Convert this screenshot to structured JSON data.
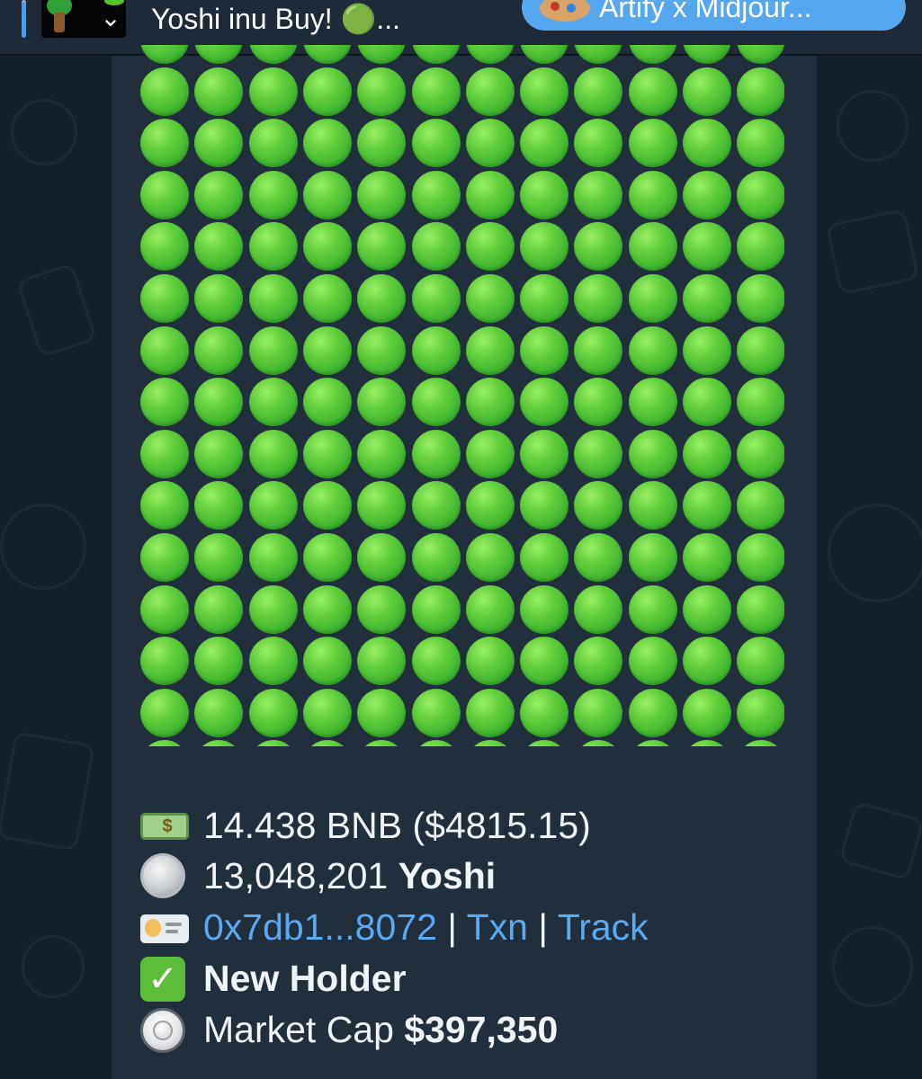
{
  "pinned": {
    "title": "Yoshi inu Buy! 🟢...",
    "button_label": "Artify x Midjour..."
  },
  "message": {
    "dot_grid": {
      "rows": 14,
      "columns": 12,
      "emoji": "green-circle"
    },
    "amount_bnb": "14.438 BNB ($4815.15)",
    "token_amount": "13,048,201",
    "token_name": "Yoshi",
    "wallet_link": "0x7db1...8072",
    "separator": "|",
    "txn_link": "Txn",
    "track_link": "Track",
    "holder_status": "New Holder",
    "market_cap_label": "Market Cap",
    "market_cap_value": "$397,350"
  },
  "icons": {
    "amount": "money-bill-icon",
    "token": "coin-icon",
    "wallet": "id-card-icon",
    "holder": "check-mark-icon",
    "market_cap": "radio-button-icon"
  },
  "colors": {
    "background": "#16202b",
    "bubble": "#212e3c",
    "link": "#5aaaf3",
    "green_circle": "#4dbd32",
    "accent_button": "#55a8f0"
  }
}
